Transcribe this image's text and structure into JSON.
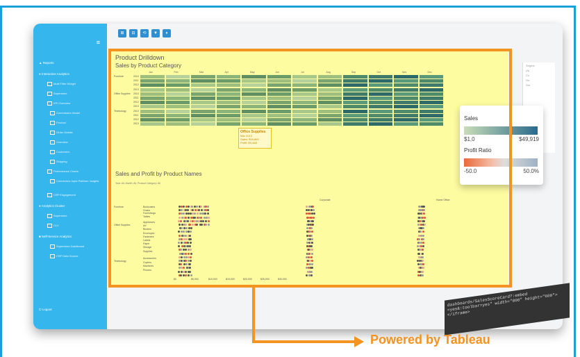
{
  "banner": {
    "text": "Powered by Tableau"
  },
  "sidebar": {
    "items": [
      {
        "label": "Reports"
      },
      {
        "label": "Interactive Analytics"
      },
      {
        "label": "Analytics Cluster"
      },
      {
        "label": "Self-Service Analytics"
      },
      {
        "label": "Logout"
      }
    ],
    "sub_items": [
      {
        "label": "Multi Filter Widget"
      },
      {
        "label": "Superstore"
      },
      {
        "label": "KPI Overview"
      },
      {
        "label": "Commission Model"
      },
      {
        "label": "Product"
      },
      {
        "label": "Order Details"
      },
      {
        "label": "Overview"
      },
      {
        "label": "Customers"
      },
      {
        "label": "Shipping"
      },
      {
        "label": "Performance Charts"
      },
      {
        "label": "Connectors Input Platform Insights"
      },
      {
        "label": "CSP Engagement"
      },
      {
        "label": "Superstore"
      },
      {
        "label": "CLV"
      },
      {
        "label": "Superstore Dashboard"
      },
      {
        "label": "CSP Data Source"
      }
    ]
  },
  "toolbar": {
    "buttons": [
      "⊞",
      "⊟",
      "⟲",
      "▼",
      "⏸"
    ]
  },
  "dashboard": {
    "title": "Product Drilldown",
    "section1_title": "Sales by Product Category",
    "months": [
      "Jan",
      "Feb",
      "Mar",
      "Apr",
      "May",
      "Jun",
      "Jul",
      "Aug",
      "Sep",
      "Oct",
      "Nov",
      "Dec"
    ],
    "categories": [
      "Furniture",
      "Office Supplies",
      "Technology"
    ],
    "years": [
      "2010",
      "2011",
      "2012",
      "2013"
    ],
    "tooltip": {
      "title": "Office Supplies",
      "month": "Mar 2013",
      "sales": "Sales: $16,860",
      "profit": "Profit: $3,468"
    },
    "section2_title": "Sales and Profit by Product Names",
    "section2_sub": "Year: All, Month: All, Product Category: All",
    "facets": [
      "Corporate",
      "Home Office"
    ],
    "subcategories_furniture": [
      "Bookcases",
      "Chairs",
      "Furnishings",
      "Tables"
    ],
    "subcategories_office": [
      "Appliances",
      "Art",
      "Binders",
      "Envelopes",
      "Fasteners",
      "Labels",
      "Paper",
      "Storage",
      "Supplies"
    ],
    "subcategories_tech": [
      "Accessories",
      "Copiers",
      "Machines",
      "Phones"
    ],
    "axis_ticks": [
      "$0",
      "$5,000",
      "$10,000",
      "$15,000",
      "$20,000",
      "$25,000",
      "$30,000"
    ]
  },
  "legend": {
    "sales_title": "Sales",
    "sales_min": "$1,0",
    "sales_max": "$49,919",
    "profit_title": "Profit Ratio",
    "profit_min": "-50.0",
    "profit_max": "50.0%"
  },
  "right_panel": {
    "title": "Segme",
    "items": [
      "(A)",
      "Co",
      "Ho",
      "Sm",
      "(A)"
    ]
  },
  "code": {
    "text": "dashboards/SalesScoreCard?:embed =yes&:toolbar=yes\" width=\"800\" height=\"600\"></iframe>"
  },
  "colors": {
    "brand_blue": "#35b6ec",
    "orange": "#f39322",
    "dash_bg": "#fdfca0"
  }
}
